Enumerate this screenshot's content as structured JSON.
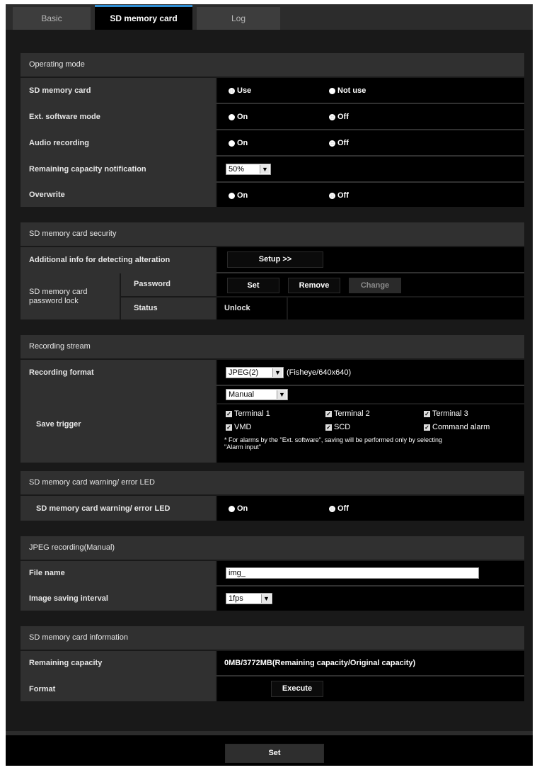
{
  "tabs": [
    "Basic",
    "SD memory card",
    "Log"
  ],
  "operating_mode": {
    "title": "Operating mode",
    "sd_card": {
      "label": "SD memory card",
      "opt_use": "Use",
      "opt_not_use": "Not use",
      "selected": "Use"
    },
    "ext_software": {
      "label": "Ext. software mode",
      "opt_on": "On",
      "opt_off": "Off",
      "selected": "Off"
    },
    "audio": {
      "label": "Audio recording",
      "opt_on": "On",
      "opt_off": "Off",
      "selected": "Off"
    },
    "remaining": {
      "label": "Remaining capacity notification",
      "value": "50%"
    },
    "overwrite": {
      "label": "Overwrite",
      "opt_on": "On",
      "opt_off": "Off",
      "selected": "Off"
    }
  },
  "security": {
    "title": "SD memory card security",
    "alteration": {
      "label": "Additional info for detecting alteration",
      "button": "Setup >>"
    },
    "lock": {
      "label": "SD memory card password lock",
      "password_label": "Password",
      "set": "Set",
      "remove": "Remove",
      "change": "Change",
      "status_label": "Status",
      "status_value": "Unlock"
    }
  },
  "recording_stream": {
    "title": "Recording stream",
    "format": {
      "label": "Recording format",
      "value": "JPEG(2)",
      "note": "(Fisheye/640x640)"
    },
    "trigger": {
      "label": "Save trigger",
      "value": "Manual",
      "options": [
        "Terminal 1",
        "Terminal 2",
        "Terminal 3",
        "VMD",
        "SCD",
        "Command alarm"
      ],
      "note_line1": "* For alarms by the \"Ext. software\", saving will be performed only by selecting",
      "note_line2": "\"Alarm input\""
    }
  },
  "led": {
    "title": "SD memory card warning/ error LED",
    "row": {
      "label": "SD memory card warning/ error LED",
      "opt_on": "On",
      "opt_off": "Off",
      "selected": "Off"
    }
  },
  "jpeg": {
    "title": "JPEG recording(Manual)",
    "filename": {
      "label": "File name",
      "value": "img_"
    },
    "interval": {
      "label": "Image saving interval",
      "value": "1fps"
    }
  },
  "info": {
    "title": "SD memory card information",
    "remaining": {
      "label": "Remaining capacity",
      "value": "0MB/3772MB(Remaining capacity/Original capacity)"
    },
    "format": {
      "label": "Format",
      "button": "Execute"
    }
  },
  "footer": {
    "set": "Set"
  },
  "colors": {
    "accent_tab": "#2f8fd6",
    "panel": "#303030",
    "background": "#191919"
  }
}
